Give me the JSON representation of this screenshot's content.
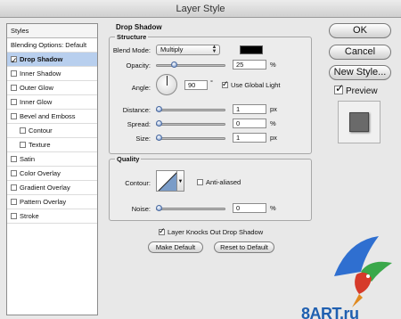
{
  "window": {
    "title": "Layer Style"
  },
  "style_list": {
    "header": "Styles",
    "items": [
      {
        "label": "Blending Options: Default",
        "checkbox": false,
        "checked": false,
        "selected": false,
        "indent": false
      },
      {
        "label": "Drop Shadow",
        "checkbox": true,
        "checked": true,
        "selected": true,
        "indent": false
      },
      {
        "label": "Inner Shadow",
        "checkbox": true,
        "checked": false,
        "selected": false,
        "indent": false
      },
      {
        "label": "Outer Glow",
        "checkbox": true,
        "checked": false,
        "selected": false,
        "indent": false
      },
      {
        "label": "Inner Glow",
        "checkbox": true,
        "checked": false,
        "selected": false,
        "indent": false
      },
      {
        "label": "Bevel and Emboss",
        "checkbox": true,
        "checked": false,
        "selected": false,
        "indent": false
      },
      {
        "label": "Contour",
        "checkbox": true,
        "checked": false,
        "selected": false,
        "indent": true
      },
      {
        "label": "Texture",
        "checkbox": true,
        "checked": false,
        "selected": false,
        "indent": true
      },
      {
        "label": "Satin",
        "checkbox": true,
        "checked": false,
        "selected": false,
        "indent": false
      },
      {
        "label": "Color Overlay",
        "checkbox": true,
        "checked": false,
        "selected": false,
        "indent": false
      },
      {
        "label": "Gradient Overlay",
        "checkbox": true,
        "checked": false,
        "selected": false,
        "indent": false
      },
      {
        "label": "Pattern Overlay",
        "checkbox": true,
        "checked": false,
        "selected": false,
        "indent": false
      },
      {
        "label": "Stroke",
        "checkbox": true,
        "checked": false,
        "selected": false,
        "indent": false
      }
    ]
  },
  "drop_shadow": {
    "title": "Drop Shadow",
    "structure": {
      "title": "Structure",
      "blend_mode_label": "Blend Mode:",
      "blend_mode_value": "Multiply",
      "shadow_color": "#000000",
      "opacity_label": "Opacity:",
      "opacity_value": "25",
      "opacity_unit": "%",
      "opacity_level": 0.25,
      "angle_label": "Angle:",
      "angle_value": "90",
      "angle_unit": "°",
      "use_global_light_label": "Use Global Light",
      "use_global_light": true,
      "distance_label": "Distance:",
      "distance_value": "1",
      "distance_unit": "px",
      "distance_level": 0.0,
      "spread_label": "Spread:",
      "spread_value": "0",
      "spread_unit": "%",
      "spread_level": 0.0,
      "size_label": "Size:",
      "size_value": "1",
      "size_unit": "px",
      "size_level": 0.0
    },
    "quality": {
      "title": "Quality",
      "contour_label": "Contour:",
      "anti_aliased_label": "Anti-aliased",
      "anti_aliased": false,
      "noise_label": "Noise:",
      "noise_value": "0",
      "noise_unit": "%",
      "noise_level": 0.0
    },
    "knockout_label": "Layer Knocks Out Drop Shadow",
    "knockout": true,
    "make_default_label": "Make Default",
    "reset_default_label": "Reset to Default"
  },
  "buttons": {
    "ok": "OK",
    "cancel": "Cancel",
    "new_style": "New Style...",
    "preview_label": "Preview",
    "preview_checked": true
  },
  "watermark": {
    "text": "8ART.ru"
  }
}
